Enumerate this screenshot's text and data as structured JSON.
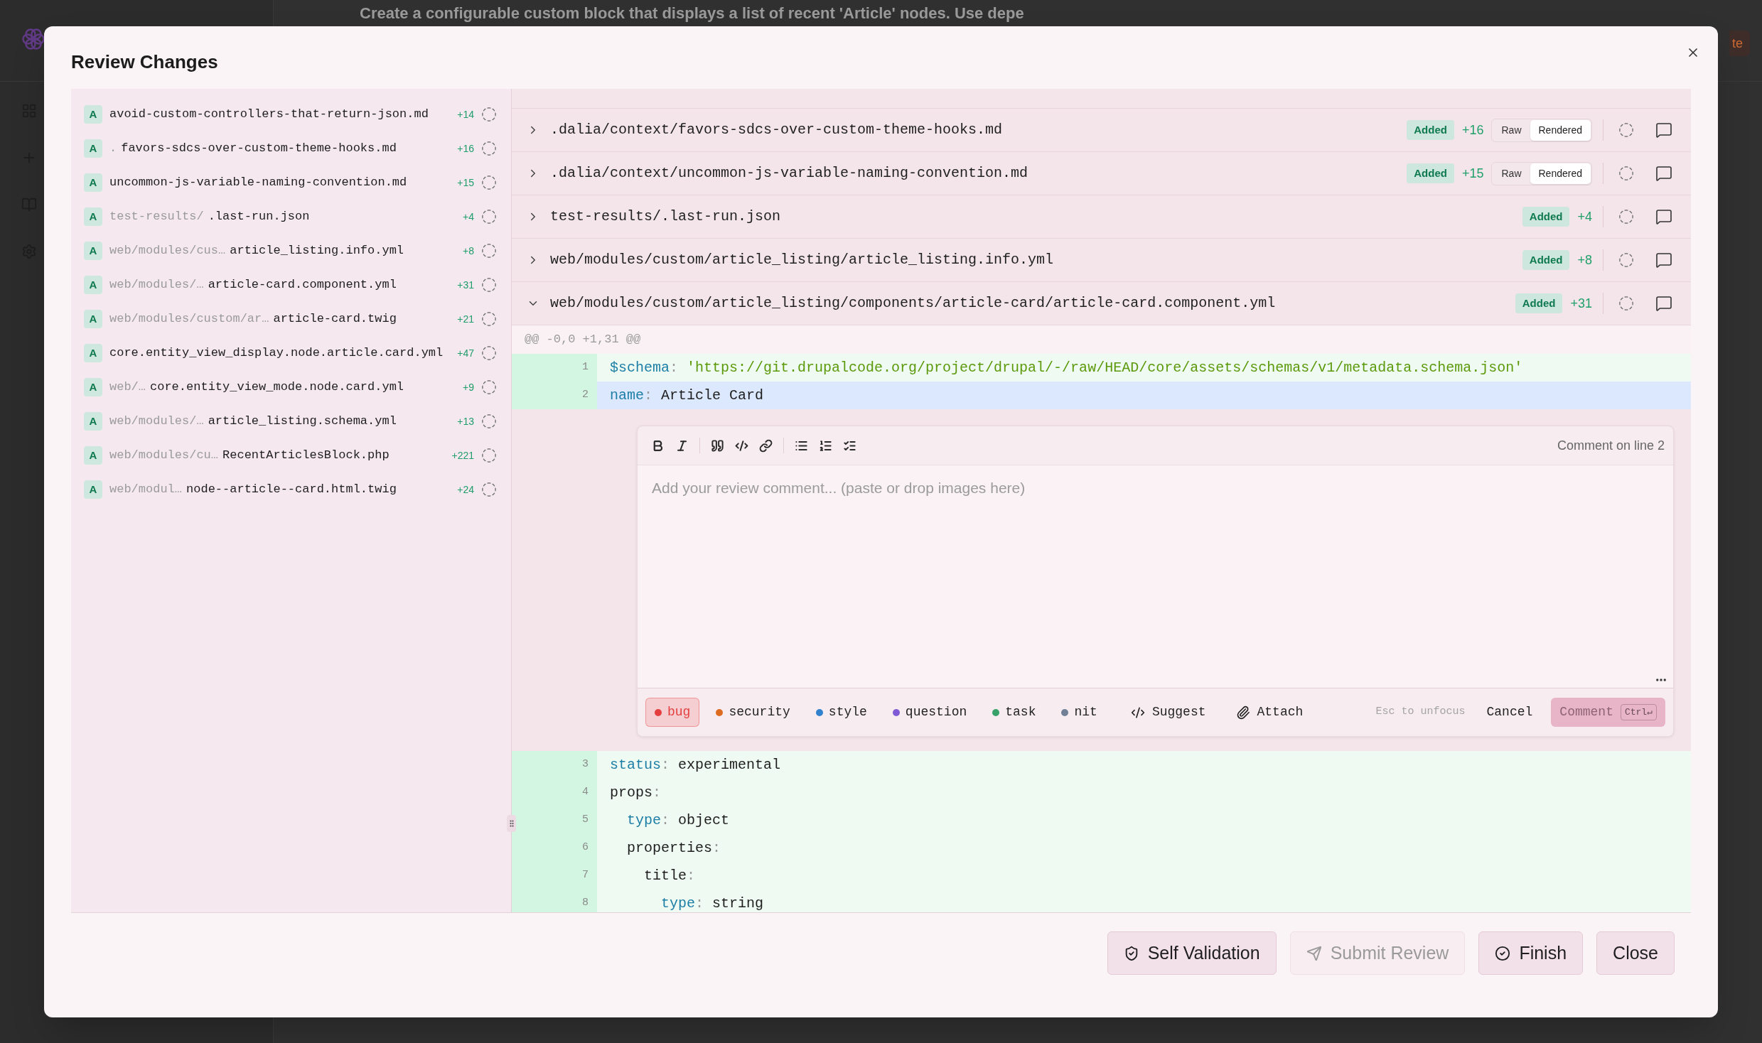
{
  "background_app": {
    "title": "Create a configurable custom block that displays a list of recent 'Article' nodes. Use depe",
    "action_button": "te"
  },
  "dialog": {
    "title": "Review Changes",
    "file_list": [
      {
        "status": "A",
        "name": "avoid-custom-controllers-that-return-json.md",
        "additions": "+14",
        "reviewed": false
      },
      {
        "status": "A",
        "dir": ".",
        "name": "favors-sdcs-over-custom-theme-hooks.md",
        "additions": "+16",
        "reviewed": false
      },
      {
        "status": "A",
        "name": "uncommon-js-variable-naming-convention.md",
        "additions": "+15",
        "reviewed": false
      },
      {
        "status": "A",
        "dir": "test-results/",
        "name": ".last-run.json",
        "additions": "+4",
        "reviewed": false
      },
      {
        "status": "A",
        "dir": "web/modules/cus…",
        "name": "article_listing.info.yml",
        "additions": "+8",
        "reviewed": false
      },
      {
        "status": "A",
        "dir": "web/modules/…",
        "name": "article-card.component.yml",
        "additions": "+31",
        "reviewed": false
      },
      {
        "status": "A",
        "dir": "web/modules/custom/ar…",
        "name": "article-card.twig",
        "additions": "+21",
        "reviewed": false
      },
      {
        "status": "A",
        "name": "core.entity_view_display.node.article.card.yml",
        "additions": "+47",
        "reviewed": false
      },
      {
        "status": "A",
        "dir": "web/…",
        "name": "core.entity_view_mode.node.card.yml",
        "additions": "+9",
        "reviewed": false
      },
      {
        "status": "A",
        "dir": "web/modules/…",
        "name": "article_listing.schema.yml",
        "additions": "+13",
        "reviewed": false
      },
      {
        "status": "A",
        "dir": "web/modules/cu…",
        "name": "RecentArticlesBlock.php",
        "additions": "+221",
        "reviewed": false
      },
      {
        "status": "A",
        "dir": "web/modul…",
        "name": "node--article--card.html.twig",
        "additions": "+24",
        "reviewed": false
      }
    ],
    "files": [
      {
        "path": ".dalia/context/favors-sdcs-over-custom-theme-hooks.md",
        "status_label": "Added",
        "additions": "+16",
        "view_modes": [
          {
            "label": "Raw",
            "selected": false
          },
          {
            "label": "Rendered",
            "selected": true
          }
        ],
        "expanded": false,
        "reviewed": false
      },
      {
        "path": ".dalia/context/uncommon-js-variable-naming-convention.md",
        "status_label": "Added",
        "additions": "+15",
        "view_modes": [
          {
            "label": "Raw",
            "selected": false
          },
          {
            "label": "Rendered",
            "selected": true
          }
        ],
        "expanded": false,
        "reviewed": false
      },
      {
        "path": "test-results/.last-run.json",
        "status_label": "Added",
        "additions": "+4",
        "expanded": false,
        "reviewed": false
      },
      {
        "path": "web/modules/custom/article_listing/article_listing.info.yml",
        "status_label": "Added",
        "additions": "+8",
        "expanded": false,
        "reviewed": false
      },
      {
        "path": "web/modules/custom/article_listing/components/article-card/article-card.component.yml",
        "status_label": "Added",
        "additions": "+31",
        "expanded": true,
        "reviewed": false,
        "diff": {
          "hunk": "@@ -0,0 +1,31 @@",
          "lines_above": [
            {
              "number": "1",
              "selected": false,
              "tokens": [
                {
                  "text": "$schema",
                  "kind": "key"
                },
                {
                  "text": ":",
                  "kind": "punct"
                },
                {
                  "text": " 'https://git.drupalcode.org/project/drupal/-/raw/HEAD/core/assets/schemas/v1/metadata.schema.json'",
                  "kind": "string"
                }
              ]
            },
            {
              "number": "2",
              "selected": true,
              "tokens": [
                {
                  "text": "name",
                  "kind": "key"
                },
                {
                  "text": ":",
                  "kind": "punct"
                },
                {
                  "text": " Article Card",
                  "kind": "plain"
                }
              ]
            }
          ],
          "comment_editor": {
            "target": "Comment on line 2",
            "placeholder": "Add your review comment... (paste or drop images here)",
            "tags": [
              {
                "label": "bug",
                "color": "#e53e3e",
                "selected": true
              },
              {
                "label": "security",
                "color": "#dd6b20",
                "selected": false
              },
              {
                "label": "style",
                "color": "#3182ce",
                "selected": false
              },
              {
                "label": "question",
                "color": "#805ad5",
                "selected": false
              },
              {
                "label": "task",
                "color": "#38a169",
                "selected": false
              },
              {
                "label": "nit",
                "color": "#718096",
                "selected": false
              }
            ],
            "actions": [
              {
                "label": "Suggest",
                "kind": "suggest"
              },
              {
                "label": "Attach",
                "kind": "attach"
              }
            ],
            "hint": "Esc to unfocus",
            "cancel": "Cancel",
            "submit": {
              "label": "Comment",
              "shortcut": "Ctrl↵",
              "disabled": true
            }
          },
          "lines_below": [
            {
              "number": "3",
              "selected": false,
              "tokens": [
                {
                  "text": "status",
                  "kind": "key"
                },
                {
                  "text": ":",
                  "kind": "punct"
                },
                {
                  "text": " experimental",
                  "kind": "plain"
                }
              ]
            },
            {
              "number": "4",
              "selected": false,
              "tokens": [
                {
                  "text": "props",
                  "kind": "plain"
                },
                {
                  "text": ":",
                  "kind": "punct"
                }
              ]
            },
            {
              "number": "5",
              "selected": false,
              "tokens": [
                {
                  "text": "  type",
                  "kind": "key"
                },
                {
                  "text": ":",
                  "kind": "punct"
                },
                {
                  "text": " object",
                  "kind": "plain"
                }
              ]
            },
            {
              "number": "6",
              "selected": false,
              "tokens": [
                {
                  "text": "  properties",
                  "kind": "plain"
                },
                {
                  "text": ":",
                  "kind": "punct"
                }
              ]
            },
            {
              "number": "7",
              "selected": false,
              "tokens": [
                {
                  "text": "    title",
                  "kind": "plain"
                },
                {
                  "text": ":",
                  "kind": "punct"
                }
              ]
            },
            {
              "number": "8",
              "selected": false,
              "tokens": [
                {
                  "text": "      type",
                  "kind": "key"
                },
                {
                  "text": ":",
                  "kind": "punct"
                },
                {
                  "text": " string",
                  "kind": "plain"
                }
              ]
            }
          ]
        }
      }
    ],
    "buttons": [
      {
        "label": "Self Validation",
        "kind": "shield",
        "disabled": false
      },
      {
        "label": "Submit Review",
        "kind": "send",
        "disabled": true
      },
      {
        "label": "Finish",
        "kind": "check",
        "disabled": false
      },
      {
        "label": "Close",
        "kind": "plain",
        "disabled": false
      }
    ]
  }
}
